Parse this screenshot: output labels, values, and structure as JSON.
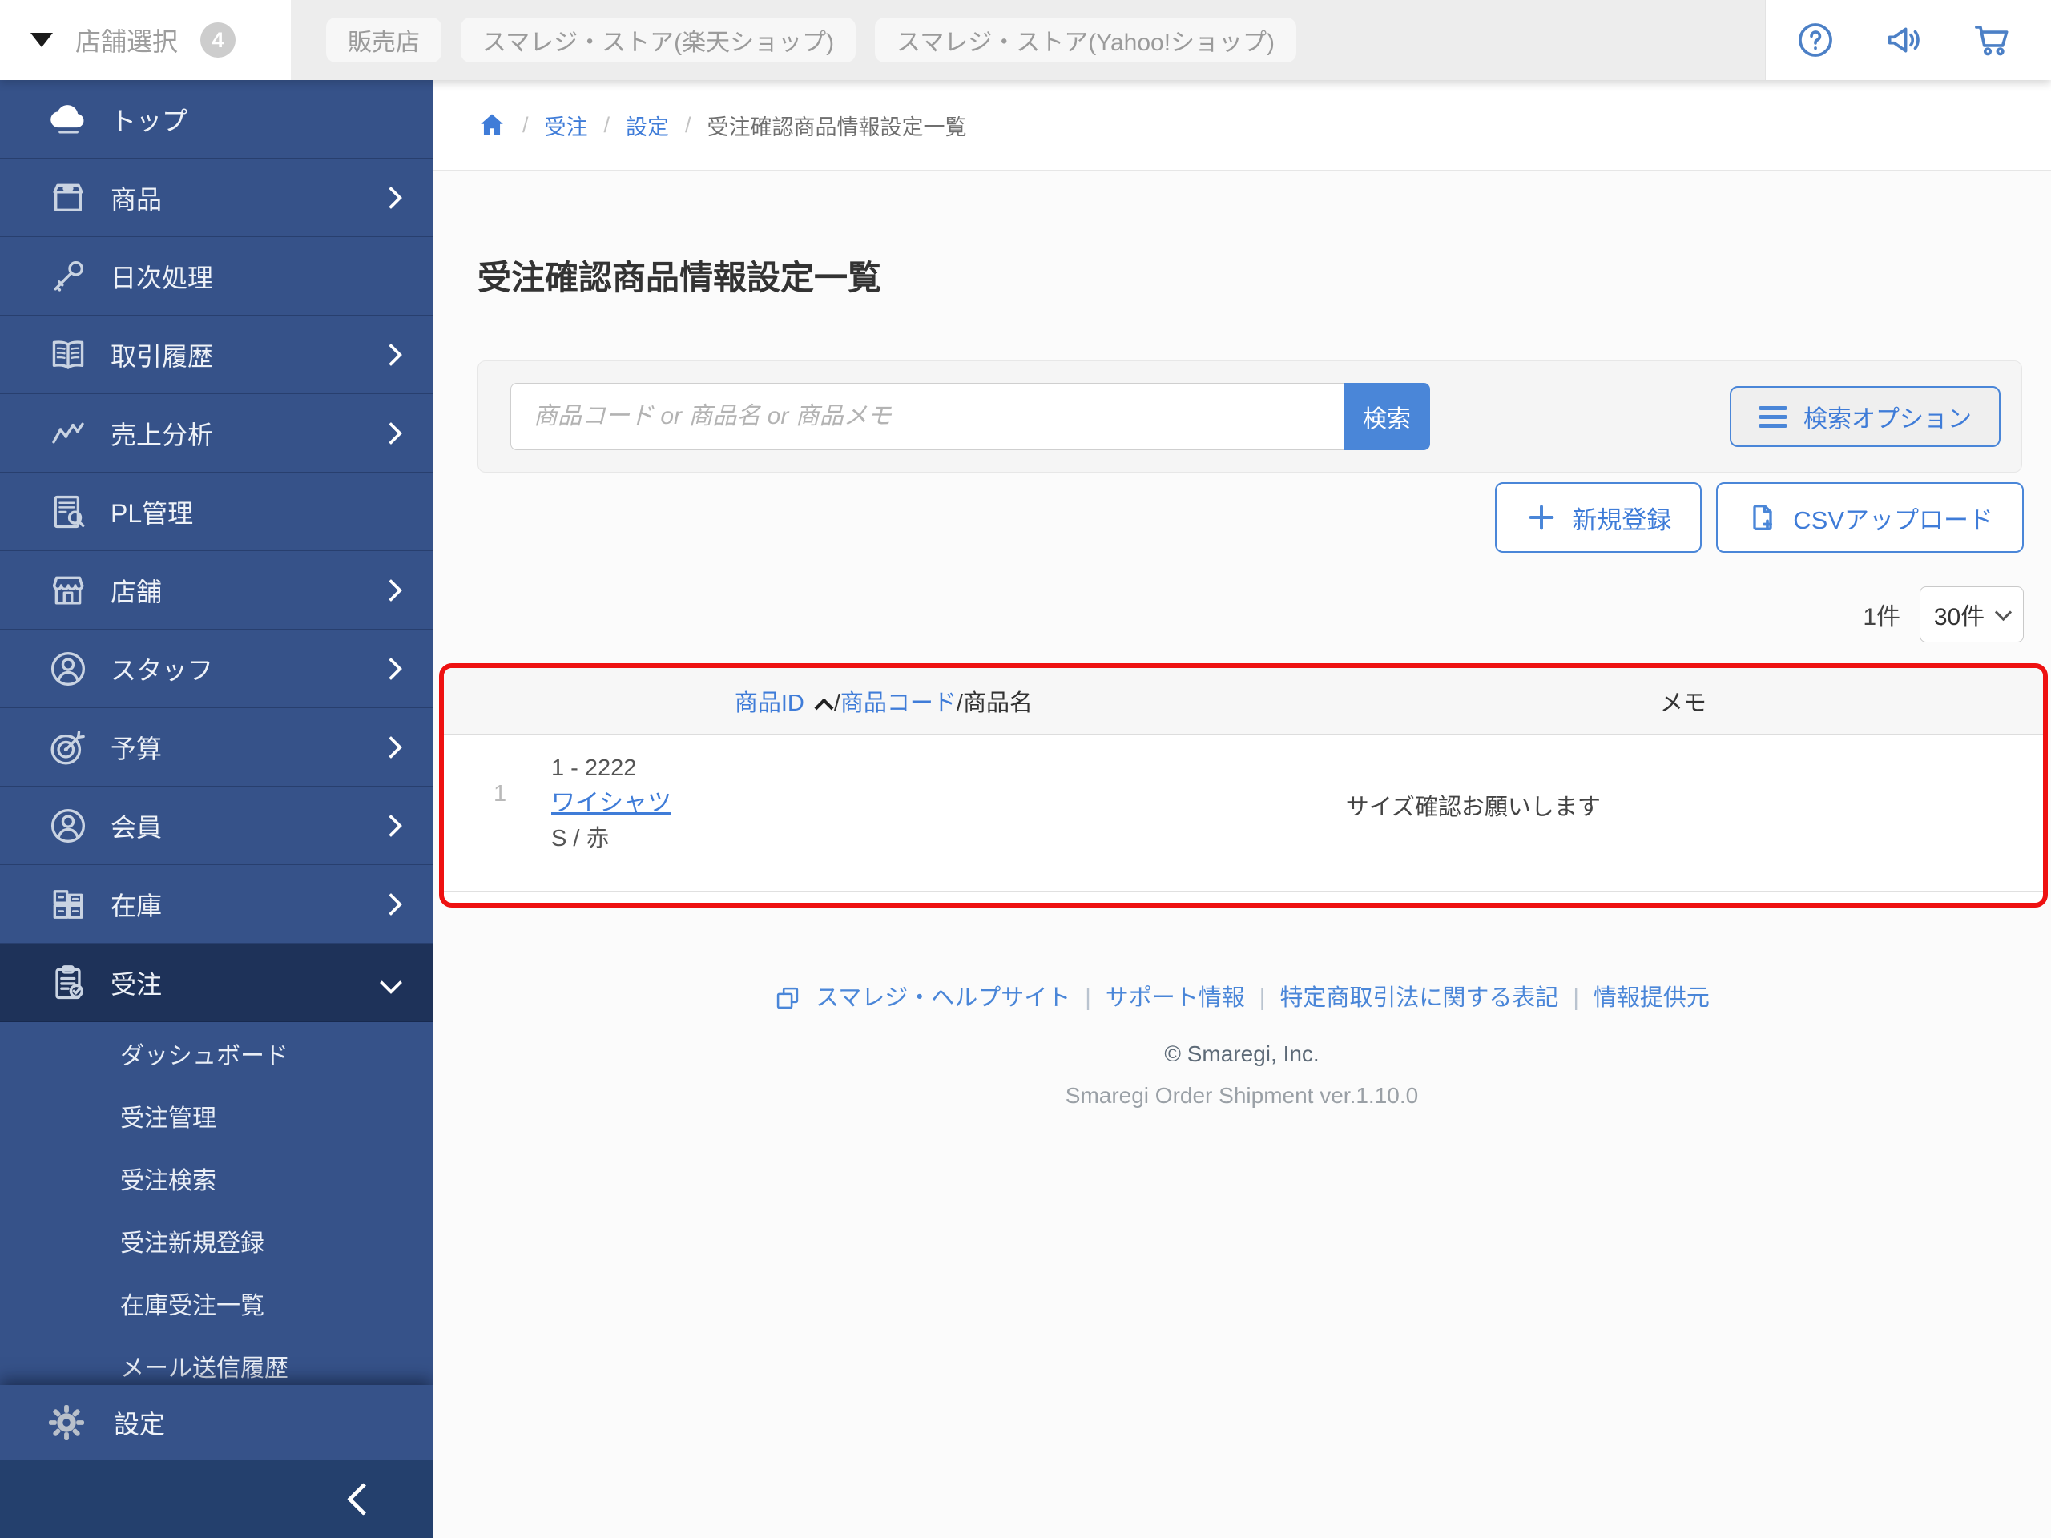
{
  "colors": {
    "accent_blue": "#4a86d8",
    "sidebar_blue": "#365289",
    "sidebar_active": "#1e3259",
    "collapse_bar": "#24406d",
    "annotation_red": "#ee1111",
    "topbar_gray": "#ededed"
  },
  "topbar": {
    "store_selector": {
      "label": "店舗選択",
      "badge": "4"
    },
    "chips": [
      {
        "label": "販売店"
      },
      {
        "label": "スマレジ・ストア(楽天ショップ)"
      },
      {
        "label": "スマレジ・ストア(Yahoo!ショップ)"
      }
    ]
  },
  "sidebar": {
    "items": [
      {
        "label": "トップ",
        "icon": "cloud-icon"
      },
      {
        "label": "商品",
        "icon": "box-icon"
      },
      {
        "label": "日次処理",
        "icon": "key-icon"
      },
      {
        "label": "取引履歴",
        "icon": "book-icon"
      },
      {
        "label": "売上分析",
        "icon": "chart-icon"
      },
      {
        "label": "PL管理",
        "icon": "pl-document-icon"
      },
      {
        "label": "店舗",
        "icon": "store-icon"
      },
      {
        "label": "スタッフ",
        "icon": "staff-icon"
      },
      {
        "label": "予算",
        "icon": "target-icon"
      },
      {
        "label": "会員",
        "icon": "member-icon"
      },
      {
        "label": "在庫",
        "icon": "inventory-icon"
      },
      {
        "label": "受注",
        "icon": "clipboard-check-icon"
      }
    ],
    "submenu": [
      {
        "label": "ダッシュボード"
      },
      {
        "label": "受注管理"
      },
      {
        "label": "受注検索"
      },
      {
        "label": "受注新規登録"
      },
      {
        "label": "在庫受注一覧"
      },
      {
        "label": "メール送信履歴"
      }
    ],
    "settings_label": "設定"
  },
  "breadcrumb": {
    "links": [
      "受注",
      "設定"
    ],
    "current": "受注確認商品情報設定一覧",
    "separator": "/"
  },
  "page": {
    "title": "受注確認商品情報設定一覧"
  },
  "search": {
    "placeholder": "商品コード or 商品名 or 商品メモ",
    "submit_label": "検索",
    "options_label": "検索オプション"
  },
  "actions": {
    "new_label": "新規登録",
    "csv_label": "CSVアップロード"
  },
  "list_meta": {
    "total_count": "1件",
    "page_size": "30件"
  },
  "table": {
    "header": {
      "product_id": "商品ID",
      "slash1": "/",
      "product_code": "商品コード",
      "product_name_suffix": "/商品名",
      "memo": "メモ"
    },
    "rows": [
      {
        "row_number": "1",
        "id_code": "1 - 2222",
        "product_name": "ワイシャツ",
        "variant": "S / 赤",
        "memo": "サイズ確認お願いします"
      }
    ]
  },
  "footer": {
    "links": [
      "スマレジ・ヘルプサイト",
      "サポート情報",
      "特定商取引法に関する表記",
      "情報提供元"
    ],
    "separator": "|",
    "copyright": "© Smaregi, Inc.",
    "version": "Smaregi Order Shipment ver.1.10.0"
  }
}
